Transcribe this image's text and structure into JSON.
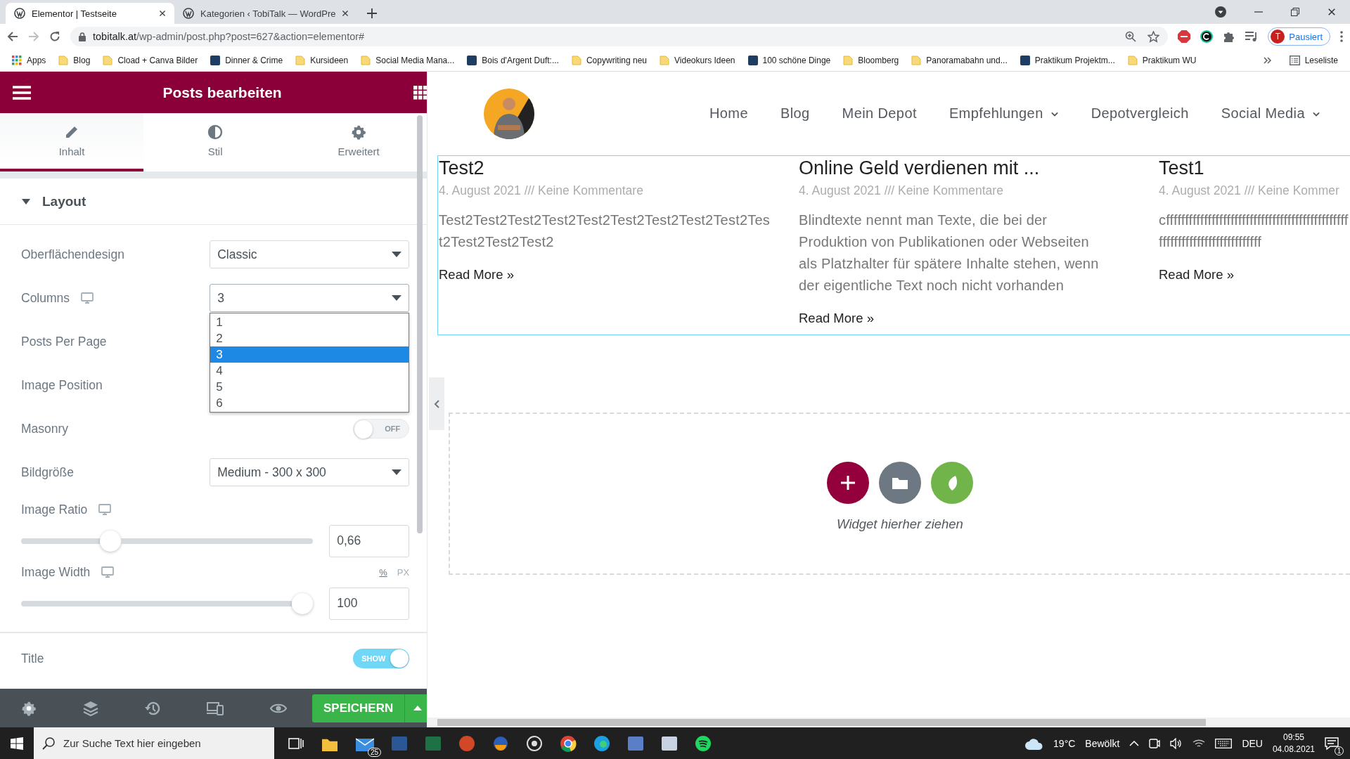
{
  "browser": {
    "tabs": [
      {
        "title": "Elementor | Testseite",
        "selected": true
      },
      {
        "title": "Kategorien ‹ TobiTalk — WordPre",
        "selected": false
      }
    ],
    "address": {
      "host": "tobitalk.at",
      "path": "/wp-admin/post.php?post=627&action=elementor#"
    },
    "profile": {
      "initial": "T",
      "label": "Pausiert"
    },
    "bookmarks": [
      {
        "kind": "apps",
        "label": "Apps"
      },
      {
        "kind": "folder",
        "label": "Blog"
      },
      {
        "kind": "folder",
        "label": "Cload + Canva Bilder"
      },
      {
        "kind": "site",
        "label": "Dinner & Crime"
      },
      {
        "kind": "folder",
        "label": "Kursideen"
      },
      {
        "kind": "folder",
        "label": "Social Media Mana..."
      },
      {
        "kind": "site",
        "label": "Bois d'Argent Duft:..."
      },
      {
        "kind": "folder",
        "label": "Copywriting neu"
      },
      {
        "kind": "folder",
        "label": "Videokurs Ideen"
      },
      {
        "kind": "site",
        "label": "100 schöne Dinge"
      },
      {
        "kind": "folder",
        "label": "Bloomberg"
      },
      {
        "kind": "folder",
        "label": "Panoramabahn und..."
      },
      {
        "kind": "site",
        "label": "Praktikum Projektm..."
      },
      {
        "kind": "folder",
        "label": "Praktikum WU"
      }
    ],
    "reading_list": "Leseliste"
  },
  "editor": {
    "title": "Posts bearbeiten",
    "tabs": [
      {
        "label": "Inhalt",
        "selected": true
      },
      {
        "label": "Stil",
        "selected": false
      },
      {
        "label": "Erweitert",
        "selected": false
      }
    ],
    "section": {
      "title": "Layout",
      "expanded": true
    },
    "controls": [
      {
        "kind": "select",
        "label": "Oberflächendesign",
        "value": "Classic"
      },
      {
        "kind": "select",
        "label": "Columns",
        "responsive": true,
        "value": "3",
        "open": true,
        "options": [
          {
            "label": "1",
            "selected": false
          },
          {
            "label": "2",
            "selected": false
          },
          {
            "label": "3",
            "selected": true
          },
          {
            "label": "4",
            "selected": false
          },
          {
            "label": "5",
            "selected": false
          },
          {
            "label": "6",
            "selected": false
          }
        ]
      },
      {
        "kind": "label",
        "label": "Posts Per Page"
      },
      {
        "kind": "label",
        "label": "Image Position"
      },
      {
        "kind": "toggle",
        "label": "Masonry",
        "on": false,
        "text": "OFF"
      },
      {
        "kind": "select",
        "label": "Bildgröße",
        "value": "Medium - 300 x 300"
      },
      {
        "kind": "slider",
        "label": "Image Ratio",
        "responsive": true,
        "level": 0.29,
        "value": "0,66"
      },
      {
        "kind": "slider",
        "label": "Image Width",
        "responsive": true,
        "level": 1,
        "value": "100",
        "units": [
          {
            "label": "%",
            "selected": true
          },
          {
            "label": "PX",
            "selected": false
          }
        ]
      },
      {
        "kind": "toggle",
        "label": "Title",
        "on": true,
        "text": "SHOW",
        "separated": true
      }
    ],
    "save_button": "SPEICHERN"
  },
  "preview": {
    "nav": [
      {
        "label": "Home",
        "submenu": false
      },
      {
        "label": "Blog",
        "submenu": false
      },
      {
        "label": "Mein Depot",
        "submenu": false
      },
      {
        "label": "Empfehlungen",
        "submenu": true
      },
      {
        "label": "Depotvergleich",
        "submenu": false
      },
      {
        "label": "Social Media",
        "submenu": true
      }
    ],
    "posts": [
      {
        "title": "Test2",
        "meta": "4. August 2021 /// Keine Kommentare",
        "excerpt": "Test2Test2Test2Test2Test2Test2Test2Test2Test2Test2Test2Test2Test2",
        "link": "Read More »"
      },
      {
        "title": "Online Geld verdienen mit ...",
        "meta": "4. August 2021 /// Keine Kommentare",
        "excerpt": "Blindtexte nennt man Texte, die bei der Produktion von Publikationen oder Webseiten als Platzhalter für spätere Inhalte stehen, wenn der eigentliche Text noch nicht vorhanden",
        "link": "Read More »"
      },
      {
        "title": "Test1",
        "meta": "4. August 2021 /// Keine Kommer",
        "excerpt": "cfffffffffffffffffffffffffffffffffffffffffffffffffffffffffffffffffffffffffff",
        "link": "Read More »"
      }
    ],
    "drop_hint": "Widget hierher ziehen"
  },
  "taskbar": {
    "search_placeholder": "Zur Suche Text hier eingeben",
    "mail_badge": "25",
    "temperature": "19°C",
    "weather": "Bewölkt",
    "language": "DEU",
    "time": "09:55",
    "date": "04.08.2021",
    "notifications": "1"
  }
}
